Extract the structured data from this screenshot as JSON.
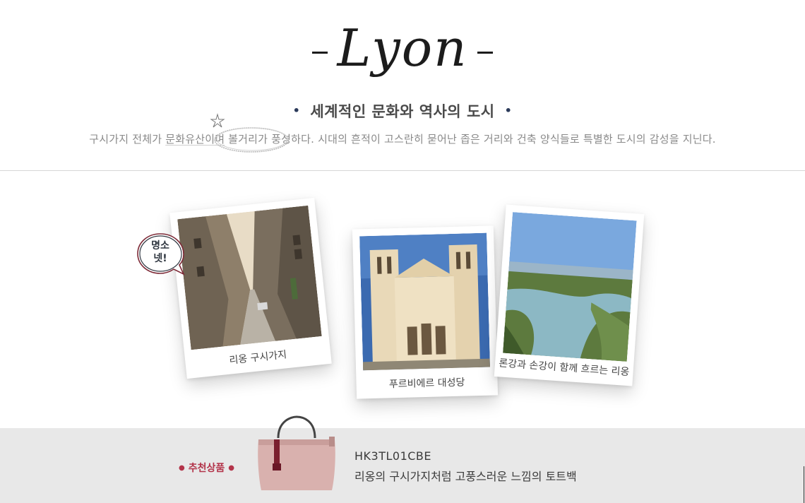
{
  "hero": {
    "city": "Lyon",
    "subtitle": "세계적인 문화와 역사의 도시",
    "description_parts": [
      "구시가지 전체가 ",
      "문화유산이며",
      " 볼거리가 풍성",
      "하다. 시대의 흔적이 고스란히 묻어난 좁은 거리와 건축 양식들로 특별한 도시의 감성을 지닌다."
    ]
  },
  "badge": {
    "text": "명소\n넷!"
  },
  "photos": [
    {
      "caption": "리옹 구시가지",
      "scene": "old-town-street"
    },
    {
      "caption": "푸르비에르 대성당",
      "scene": "basilica"
    },
    {
      "caption": "론강과 손강이 함께 흐르는 리옹",
      "scene": "river-confluence"
    }
  ],
  "recommendation": {
    "label": "추천상품",
    "product_code": "HK3TL01CBE",
    "product_name": "리옹의 구시가지처럼 고풍스러운 느낌의 토트백",
    "bag_color": "#d9b1ae"
  },
  "colors": {
    "accent": "#b3344a",
    "nav_dot": "#2b3a5a",
    "bar_bg": "#e8e8e8"
  }
}
